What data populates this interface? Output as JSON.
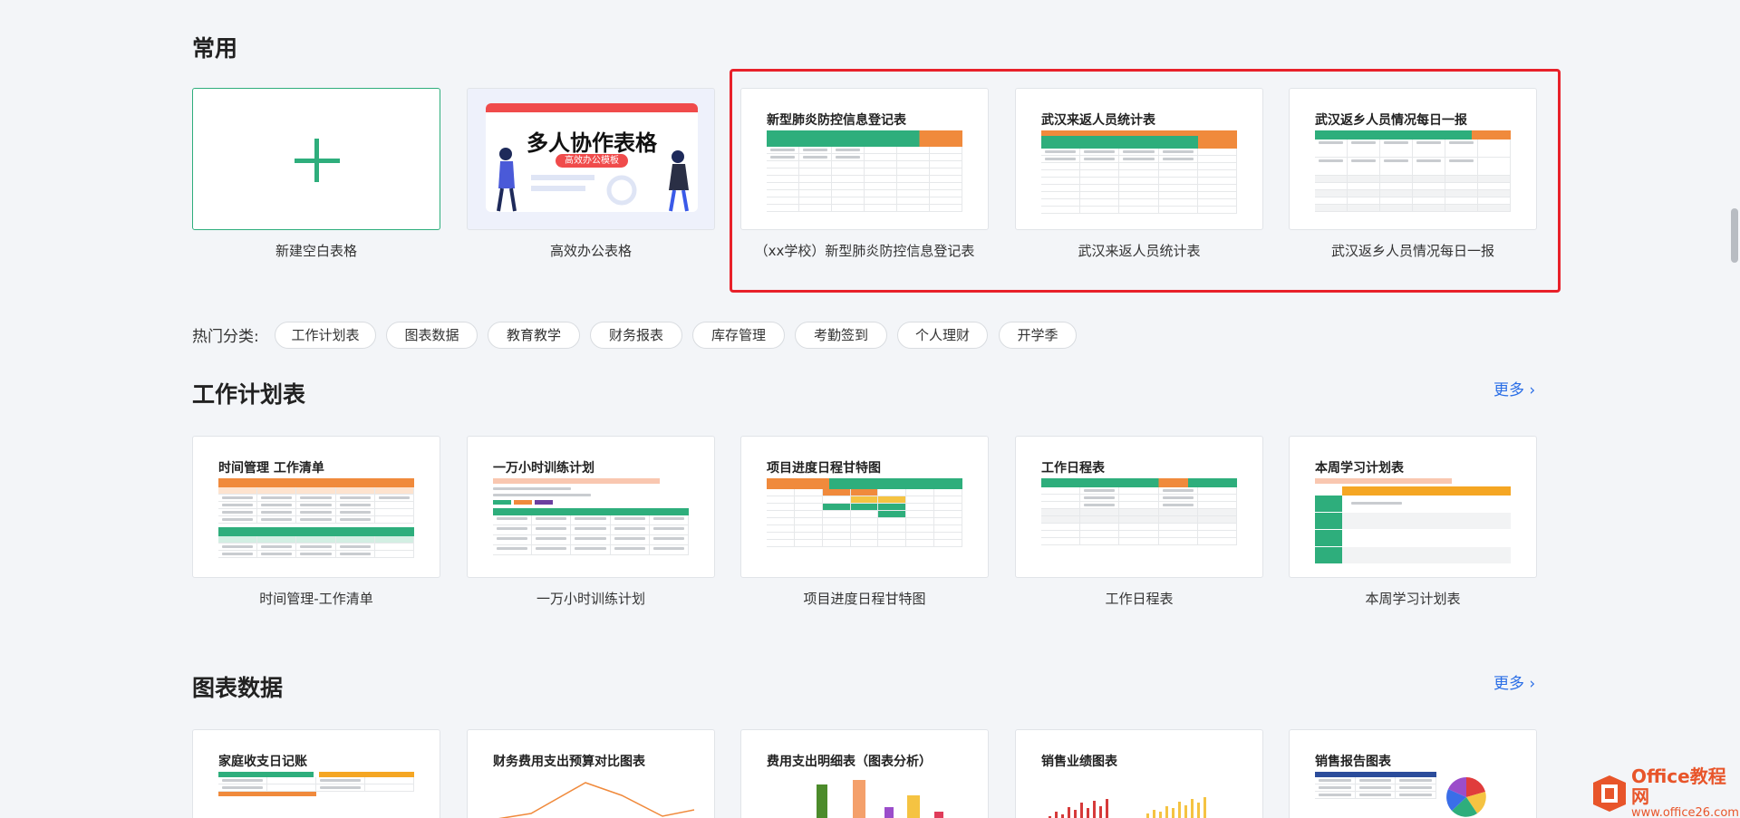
{
  "sections": {
    "common": {
      "title": "常用",
      "cards": [
        {
          "caption": "新建空白表格"
        },
        {
          "caption": "高效办公表格",
          "banner_title": "多人协作表格",
          "banner_sub": "高效办公模板"
        },
        {
          "title": "新型肺炎防控信息登记表",
          "caption": "（xx学校）新型肺炎防控信息登记表"
        },
        {
          "title": "武汉来返人员统计表",
          "caption": "武汉来返人员统计表"
        },
        {
          "title": "武汉返乡人员情况每日一报",
          "caption": "武汉返乡人员情况每日一报"
        }
      ]
    },
    "hot_categories": {
      "label": "热门分类:",
      "tags": [
        "工作计划表",
        "图表数据",
        "教育教学",
        "财务报表",
        "库存管理",
        "考勤签到",
        "个人理财",
        "开学季"
      ]
    },
    "work_plan": {
      "title": "工作计划表",
      "more": "更多 ›",
      "cards": [
        {
          "title": "时间管理 工作清单",
          "caption": "时间管理-工作清单"
        },
        {
          "title": "一万小时训练计划",
          "caption": "一万小时训练计划"
        },
        {
          "title": "项目进度日程甘特图",
          "caption": "项目进度日程甘特图"
        },
        {
          "title": "工作日程表",
          "caption": "工作日程表"
        },
        {
          "title": "本周学习计划表",
          "caption": "本周学习计划表"
        }
      ]
    },
    "chart_data_section": {
      "title": "图表数据",
      "more": "更多 ›",
      "cards": [
        {
          "title": "家庭收支日记账"
        },
        {
          "title": "财务费用支出预算对比图表"
        },
        {
          "title": "费用支出明细表（图表分析）"
        },
        {
          "title": "销售业绩图表"
        },
        {
          "title": "销售报告图表"
        }
      ]
    }
  },
  "watermark": {
    "brand": "Office教程网",
    "url": "www.office26.com"
  },
  "colors": {
    "accent_green": "#2eae7c",
    "highlight_red": "#e8212a",
    "more_blue": "#2a6ee6",
    "orange": "#f08a3c"
  },
  "icons": {
    "new_blank": "plus-icon",
    "more": "chevron-right-icon"
  }
}
